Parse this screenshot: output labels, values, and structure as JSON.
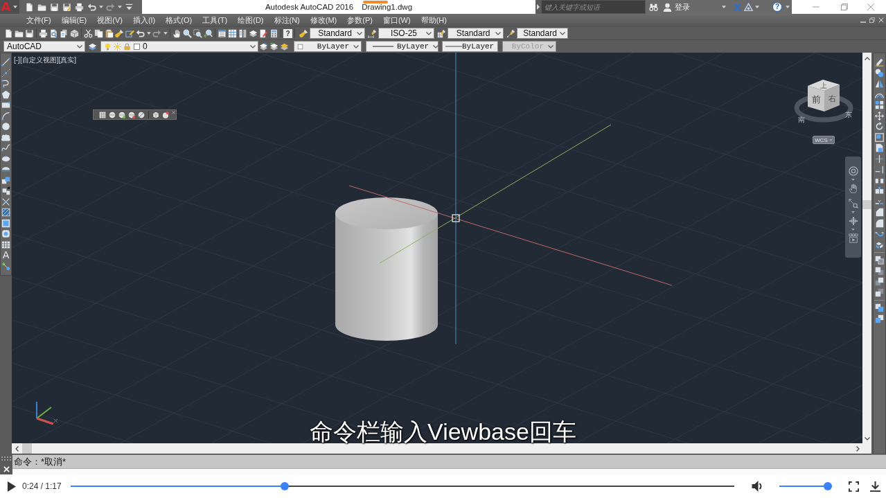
{
  "title_bar": {
    "app_logo": "A",
    "app_name": "Autodesk AutoCAD 2016",
    "file_name": "Drawing1.dwg",
    "search": {
      "placeholder": "键入关键字或短语"
    },
    "sign_in": "登录",
    "help_glyph": "?"
  },
  "menu_bar": [
    "文件(F)",
    "编辑(E)",
    "视图(V)",
    "插入(I)",
    "格式(O)",
    "工具(T)",
    "绘图(D)",
    "标注(N)",
    "修改(M)",
    "参数(P)",
    "窗口(W)",
    "帮助(H)"
  ],
  "standard_toolbar": {
    "help_glyph": "?"
  },
  "style_toolbar": [
    {
      "kind": "text",
      "value": "Standard"
    },
    {
      "kind": "dimension",
      "value": "ISO-25"
    },
    {
      "kind": "table",
      "value": "Standard"
    },
    {
      "kind": "multileader",
      "value": "Standard"
    }
  ],
  "properties_toolbar": {
    "workspace": "AutoCAD",
    "layer": "0",
    "color_setting": "ByLayer",
    "linetype": "ByLayer",
    "lineweight": "ByLayer",
    "plot_style": {
      "value": "ByColor",
      "disabled": true
    }
  },
  "draw_toolbar": {
    "text_tool": "A"
  },
  "viewport": {
    "label": "[-][自定义视图][真实]",
    "viewcube": {
      "top": "上",
      "front": "前",
      "right": "右",
      "compass": [
        "南",
        "东"
      ]
    },
    "ucs_button": "WCS"
  },
  "subtitle": "命令栏输入Viewbase回车",
  "command_line": {
    "history": "命令：*取消*"
  },
  "player": {
    "playing": false,
    "time": "0:24 / 1:17",
    "progress": {
      "level": 0.32
    },
    "volume": {
      "level": 1
    }
  }
}
